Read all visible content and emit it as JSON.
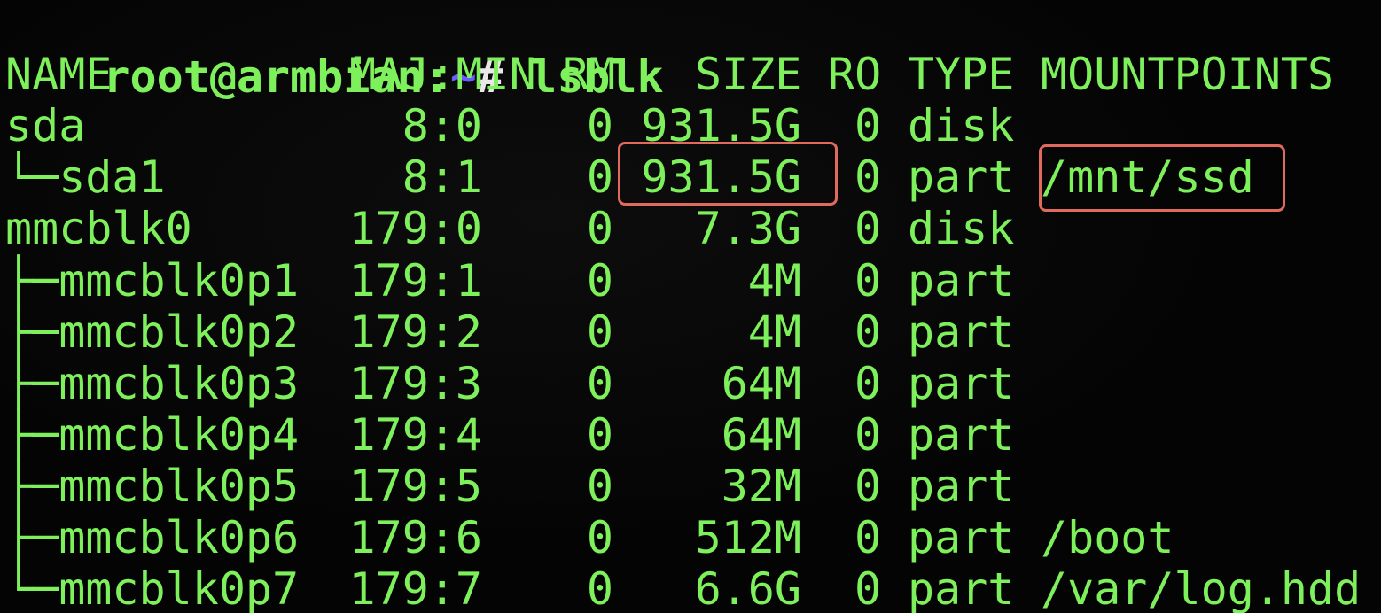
{
  "prompt": {
    "user_host": "root@armbian:",
    "cwd": "~",
    "symbol": "#",
    "command": "lsblk"
  },
  "headers": [
    "NAME",
    "MAJ:MIN",
    "RM",
    "SIZE",
    "RO",
    "TYPE",
    "MOUNTPOINTS"
  ],
  "rows": [
    {
      "name": "sda",
      "majmin": "8:0",
      "rm": "0",
      "size": "931.5G",
      "ro": "0",
      "type": "disk",
      "mount": ""
    },
    {
      "name": "└─sda1",
      "majmin": "8:1",
      "rm": "0",
      "size": "931.5G",
      "ro": "0",
      "type": "part",
      "mount": "/mnt/ssd"
    },
    {
      "name": "mmcblk0",
      "majmin": "179:0",
      "rm": "0",
      "size": "7.3G",
      "ro": "0",
      "type": "disk",
      "mount": ""
    },
    {
      "name": "├─mmcblk0p1",
      "majmin": "179:1",
      "rm": "0",
      "size": "4M",
      "ro": "0",
      "type": "part",
      "mount": ""
    },
    {
      "name": "├─mmcblk0p2",
      "majmin": "179:2",
      "rm": "0",
      "size": "4M",
      "ro": "0",
      "type": "part",
      "mount": ""
    },
    {
      "name": "├─mmcblk0p3",
      "majmin": "179:3",
      "rm": "0",
      "size": "64M",
      "ro": "0",
      "type": "part",
      "mount": ""
    },
    {
      "name": "├─mmcblk0p4",
      "majmin": "179:4",
      "rm": "0",
      "size": "64M",
      "ro": "0",
      "type": "part",
      "mount": ""
    },
    {
      "name": "├─mmcblk0p5",
      "majmin": "179:5",
      "rm": "0",
      "size": "32M",
      "ro": "0",
      "type": "part",
      "mount": ""
    },
    {
      "name": "├─mmcblk0p6",
      "majmin": "179:6",
      "rm": "0",
      "size": "512M",
      "ro": "0",
      "type": "part",
      "mount": "/boot"
    },
    {
      "name": "└─mmcblk0p7",
      "majmin": "179:7",
      "rm": "0",
      "size": "6.6G",
      "ro": "0",
      "type": "part",
      "mount": "/var/log.hdd"
    }
  ],
  "colors": {
    "text": "#7ef05c",
    "tilde": "#6b5cff",
    "highlight": "#e06a5e",
    "background": "#040404"
  }
}
